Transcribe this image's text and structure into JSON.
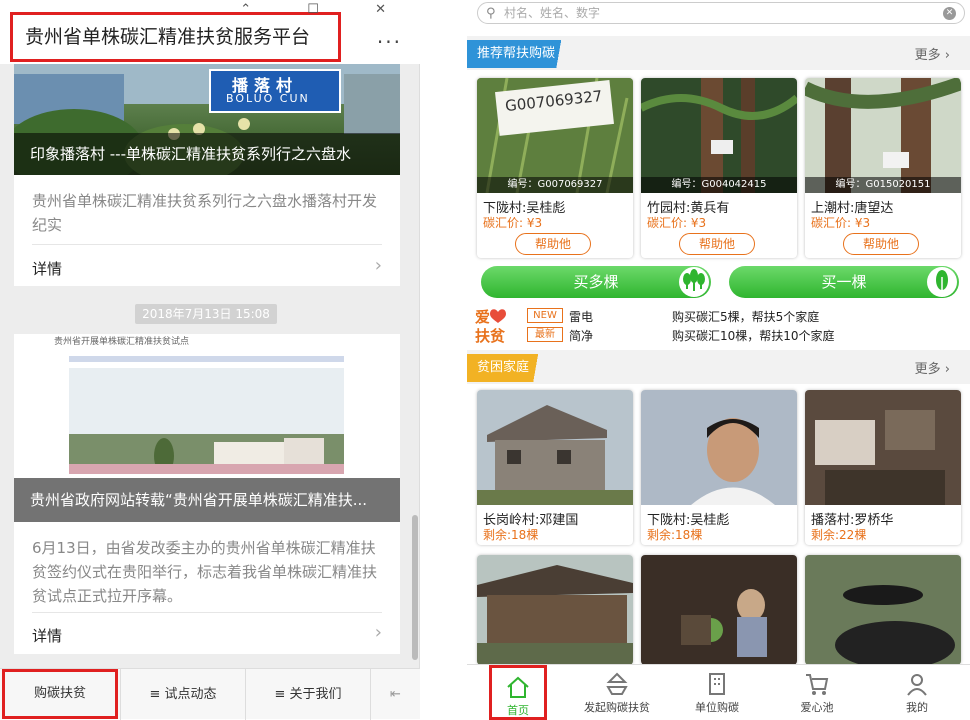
{
  "left": {
    "title": "贵州省单株碳汇精准扶贫服务平台",
    "window_controls": "⌃ ☐ ✕",
    "more_label": "···",
    "article1": {
      "caption": "印象播落村 ---单株碳汇精准扶贫系列行之六盘水",
      "sign_text": "播落村",
      "sign_sub": "BOLUO CUN",
      "description": "贵州省单株碳汇精准扶贫系列行之六盘水播落村开发纪实",
      "details_label": "详情"
    },
    "timestamp": "2018年7月13日 15:08",
    "article2": {
      "caption": "贵州省政府网站转载“贵州省开展单株碳汇精准扶...",
      "header_text": "贵州省开展单株碳汇精准扶贫试点",
      "description": "6月13日，由省发改委主办的贵州省单株碳汇精准扶贫签约仪式在贵阳举行，标志着我省单株碳汇精准扶贫试点正式拉开序幕。",
      "details_label": "详情"
    },
    "bottom_bar": [
      "购碳扶贫",
      "≡ 试点动态",
      "≡ 关于我们",
      "⇤"
    ]
  },
  "right": {
    "search_placeholder": "村名、姓名、数字",
    "recommend": {
      "title": "推荐帮扶购碳",
      "more": "更多 ›",
      "cards": [
        {
          "tag": "G007069327",
          "number": "编号：G007069327",
          "name": "下陇村:吴桂彪",
          "price": "碳汇价: ¥3",
          "button": "帮助他"
        },
        {
          "tag": "",
          "number": "编号：G004042415",
          "name": "竹园村:黄兵有",
          "price": "碳汇价: ¥3",
          "button": "帮助他"
        },
        {
          "tag": "",
          "number": "编号：G015020151",
          "name": "上潮村:唐望达",
          "price": "碳汇价: ¥3",
          "button": "帮助他"
        }
      ]
    },
    "buy_many": "买多棵",
    "buy_one": "买一棵",
    "news": {
      "logo": "爱♥\n扶贫",
      "items": [
        {
          "tag": "NEW",
          "name": "雷电",
          "text": "购买碳汇5棵，帮扶5个家庭"
        },
        {
          "tag": "最新",
          "name": "简净",
          "text": "购买碳汇10棵，帮扶10个家庭"
        }
      ]
    },
    "poor": {
      "title": "贫困家庭",
      "more": "更多 ›",
      "cards": [
        {
          "name": "长岗岭村:邓建国",
          "remain": "剩余:18棵"
        },
        {
          "name": "下陇村:吴桂彪",
          "remain": "剩余:18棵"
        },
        {
          "name": "播落村:罗桥华",
          "remain": "剩余:22棵"
        }
      ]
    },
    "nav": [
      "首页",
      "发起购碳扶贫",
      "单位购碳",
      "爱心池",
      "我的"
    ],
    "colors": {
      "green": "#2fb52f",
      "orange": "#e8721c",
      "blue": "#2f93d8",
      "yellow": "#f2b224",
      "highlight": "#e02020"
    }
  }
}
